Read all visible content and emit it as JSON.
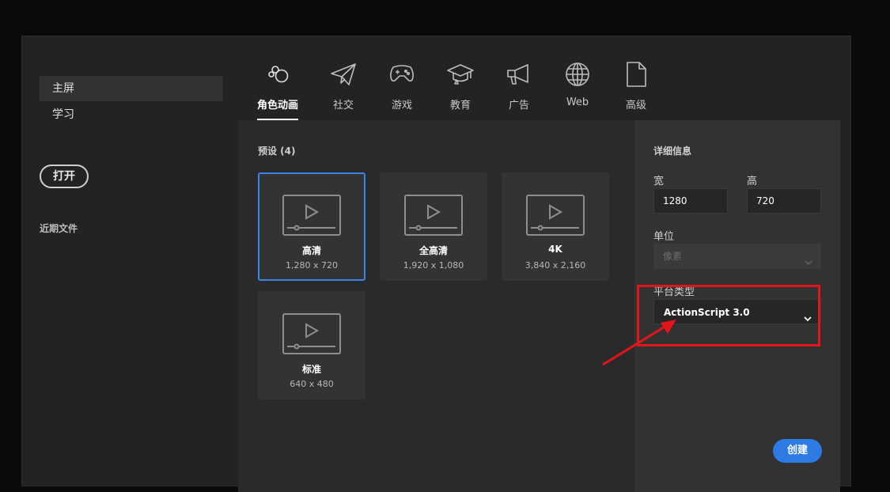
{
  "sidebar": {
    "items": [
      {
        "label": "主屏",
        "active": true
      },
      {
        "label": "学习",
        "active": false
      }
    ],
    "open_label": "打开",
    "recent_label": "近期文件"
  },
  "tabs": [
    {
      "label": "角色动画",
      "icon": "character-animation-icon",
      "active": true
    },
    {
      "label": "社交",
      "icon": "paper-plane-icon",
      "active": false
    },
    {
      "label": "游戏",
      "icon": "gamepad-icon",
      "active": false
    },
    {
      "label": "教育",
      "icon": "graduation-cap-icon",
      "active": false
    },
    {
      "label": "广告",
      "icon": "megaphone-icon",
      "active": false
    },
    {
      "label": "Web",
      "icon": "globe-icon",
      "active": false
    },
    {
      "label": "高级",
      "icon": "document-icon",
      "active": false
    }
  ],
  "presets": {
    "title": "预设 (4)",
    "items": [
      {
        "name": "高清",
        "size": "1,280 x 720",
        "selected": true
      },
      {
        "name": "全高清",
        "size": "1,920 x 1,080",
        "selected": false
      },
      {
        "name": "4K",
        "size": "3,840 x 2,160",
        "selected": false
      },
      {
        "name": "标准",
        "size": "640 x 480",
        "selected": false
      }
    ]
  },
  "details": {
    "title": "详细信息",
    "width_label": "宽",
    "width_value": "1280",
    "height_label": "高",
    "height_value": "720",
    "unit_label": "单位",
    "unit_value": "像素",
    "platform_label": "平台类型",
    "platform_value": "ActionScript 3.0",
    "create_label": "创建"
  },
  "colors": {
    "accent": "#2d7be3",
    "selected_border": "#3b86e5",
    "annotation": "#e3141a"
  }
}
